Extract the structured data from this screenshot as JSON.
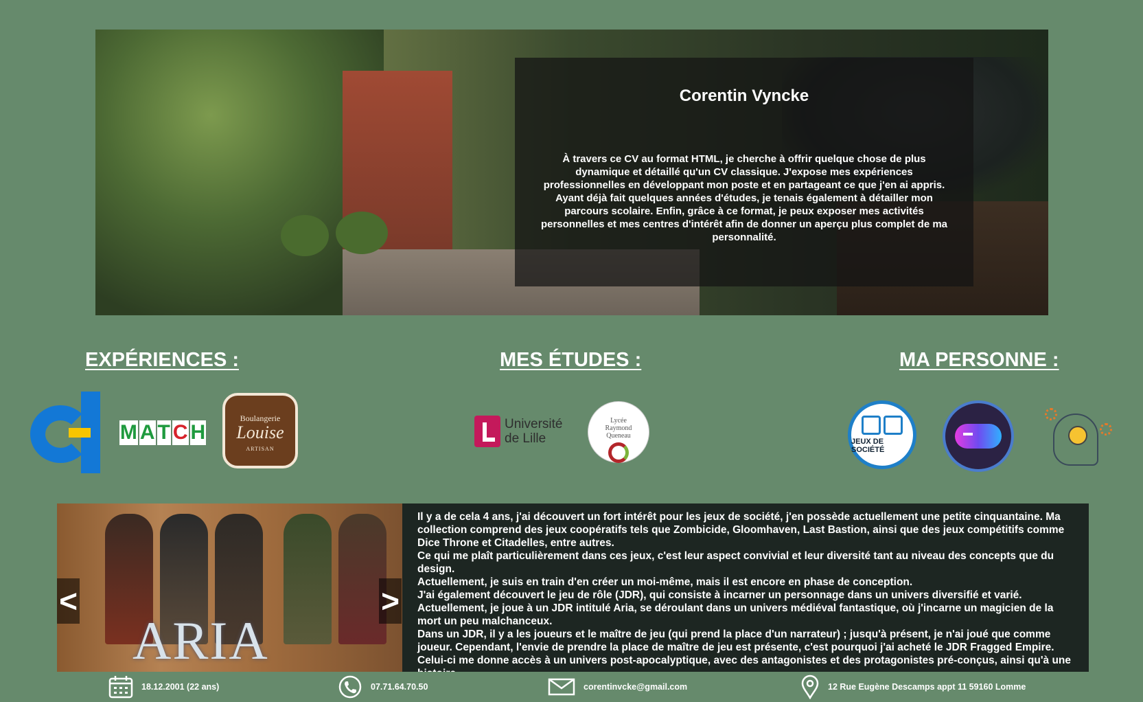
{
  "hero": {
    "name": "Corentin Vyncke",
    "intro": "À travers ce CV au format HTML, je cherche à offrir quelque chose de plus dynamique et détaillé qu'un CV classique. J'expose mes expériences professionnelles en développant mon poste et en partageant ce que j'en ai appris. Ayant déjà fait quelques années d'études, je tenais également à détailler mon parcours scolaire. Enfin, grâce à ce format, je peux exposer mes activités personnelles et mes centres d'intérêt afin de donner un aperçu plus complet de ma personnalité."
  },
  "sections": {
    "experiences": "EXPÉRIENCES :",
    "studies": "MES ÉTUDES :",
    "personal": "MA PERSONNE :"
  },
  "logos": {
    "match_letters": [
      "M",
      "A",
      "T",
      "C",
      "H"
    ],
    "louise_top": "Boulangerie",
    "louise_name": "Louise",
    "louise_bottom": "ARTISAN",
    "lille_line1": "Université",
    "lille_line2": "de Lille",
    "queneau_line1": "Lycée",
    "queneau_line2": "Raymond",
    "queneau_line3": "Queneau",
    "jeux_label": "JEUX DE SOCIÉTÉ"
  },
  "slider": {
    "prev": "<",
    "next": ">",
    "cover_title": "ARIA"
  },
  "description": {
    "lines": [
      "Il y a de cela 4 ans, j'ai découvert un fort intérêt pour les jeux de société, j'en possède actuellement une petite cinquantaine. Ma collection comprend des jeux coopératifs tels que Zombicide, Gloomhaven, Last Bastion, ainsi que des jeux compétitifs comme Dice Throne et Citadelles, entre autres.",
      "Ce qui me plaît particulièrement dans ces jeux, c'est leur aspect convivial et leur diversité tant au niveau des concepts que du design.",
      "Actuellement, je suis en train d'en créer un moi-même, mais il est encore en phase de conception.",
      "J'ai également découvert le jeu de rôle (JDR), qui consiste à incarner un personnage dans un univers diversifié et varié.",
      "Actuellement, je joue à un JDR intitulé Aria, se déroulant dans un univers médiéval fantastique, où j'incarne un magicien de la mort un peu malchanceux.",
      "Dans un JDR, il y a les joueurs et le maître de jeu (qui prend la place d'un narrateur) ; jusqu'à présent, je n'ai joué que comme joueur. Cependant, l'envie de prendre la place de maître de jeu est présente, c'est pourquoi j'ai acheté le JDR Fragged Empire.",
      "Celui-ci me donne accès à un univers post-apocalyptique, avec des antagonistes et des protagonistes pré-conçus, ainsi qu'à une histoire."
    ]
  },
  "footer": {
    "birthdate": "18.12.2001 (22 ans)",
    "phone": "07.71.64.70.50",
    "email": "corentinvcke@gmail.com",
    "address": "12 Rue Eugène Descamps appt 11 59160 Lomme"
  }
}
